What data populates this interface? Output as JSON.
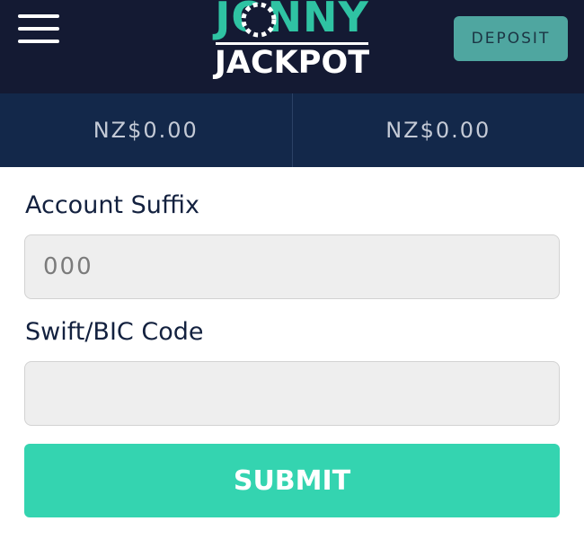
{
  "header": {
    "menu_icon": "hamburger-menu-icon",
    "logo": {
      "line1": "JONNY",
      "line2": "JACKPOT"
    },
    "deposit_label": "DEPOSIT"
  },
  "balances": [
    {
      "amount": "NZ$0.00"
    },
    {
      "amount": "NZ$0.00"
    }
  ],
  "form": {
    "account_suffix": {
      "label": "Account Suffix",
      "placeholder": "000",
      "value": ""
    },
    "swift_bic": {
      "label": "Swift/BIC Code",
      "placeholder": "",
      "value": ""
    },
    "submit_label": "SUBMIT"
  },
  "colors": {
    "header_bg": "#141a33",
    "balance_bg": "#13284a",
    "brand_teal": "#2fc3a3",
    "submit_bg": "#34d4b0",
    "deposit_bg": "#4fa6a0"
  }
}
